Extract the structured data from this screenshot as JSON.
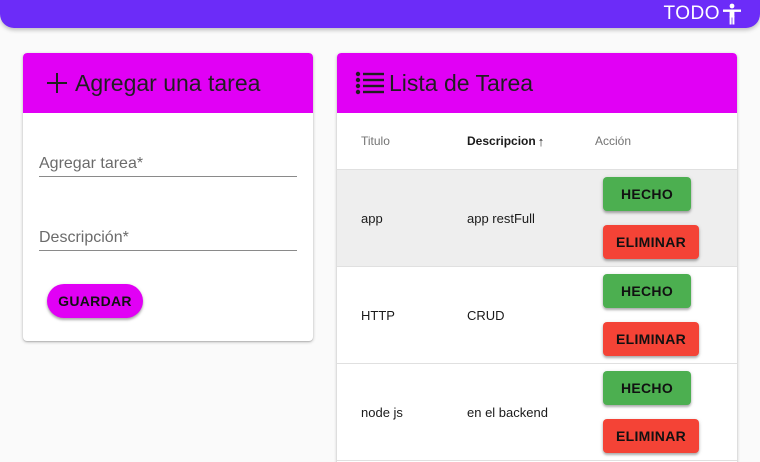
{
  "appbar": {
    "title": "TODO",
    "icon": "accessibility-icon"
  },
  "form": {
    "title": "Agregar una tarea",
    "title_icon": "plus-icon",
    "task_placeholder": "Agregar tarea*",
    "desc_placeholder": "Descripción*",
    "save_label": "GUARDAR"
  },
  "list": {
    "title": "Lista de Tarea",
    "title_icon": "list-icon",
    "columns": {
      "title": "Titulo",
      "description": "Descripcion",
      "action": "Acción"
    },
    "sorted_column": "description",
    "sort_direction": "ascending",
    "rows": [
      {
        "title": "app",
        "description": "app restFull",
        "done_label": "HECHO",
        "delete_label": "ELIMINAR",
        "highlighted": true
      },
      {
        "title": "HTTP",
        "description": "CRUD",
        "done_label": "HECHO",
        "delete_label": "ELIMINAR",
        "highlighted": false
      },
      {
        "title": "node js",
        "description": "en el backend",
        "done_label": "HECHO",
        "delete_label": "ELIMINAR",
        "highlighted": false
      }
    ]
  },
  "colors": {
    "appbar": "#6c2cf8",
    "accent": "#e100f5",
    "done": "#4caf50",
    "delete": "#f44336"
  }
}
